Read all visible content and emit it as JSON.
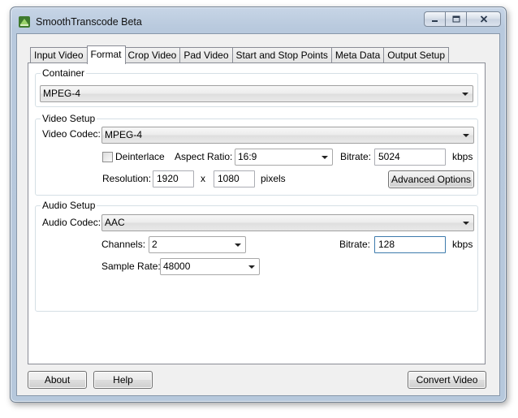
{
  "window": {
    "title": "SmoothTranscode Beta"
  },
  "tabs": [
    {
      "label": "Input Video"
    },
    {
      "label": "Format"
    },
    {
      "label": "Crop Video"
    },
    {
      "label": "Pad Video"
    },
    {
      "label": "Start and Stop Points"
    },
    {
      "label": "Meta Data"
    },
    {
      "label": "Output Setup"
    }
  ],
  "active_tab": "Format",
  "container": {
    "legend": "Container",
    "value": "MPEG-4"
  },
  "video": {
    "legend": "Video Setup",
    "codec_label": "Video Codec:",
    "codec_value": "MPEG-4",
    "deinterlace_label": "Deinterlace",
    "deinterlace_checked": false,
    "aspect_label": "Aspect Ratio:",
    "aspect_value": "16:9",
    "bitrate_label": "Bitrate:",
    "bitrate_value": "5024",
    "bitrate_unit": "kbps",
    "resolution_label": "Resolution:",
    "width_value": "1920",
    "x_label": "x",
    "height_value": "1080",
    "pixels_label": "pixels",
    "advanced_button": "Advanced Options"
  },
  "audio": {
    "legend": "Audio Setup",
    "codec_label": "Audio Codec:",
    "codec_value": "AAC",
    "channels_label": "Channels:",
    "channels_value": "2",
    "bitrate_label": "Bitrate:",
    "bitrate_value": "128",
    "bitrate_unit": "kbps",
    "samplerate_label": "Sample Rate:",
    "samplerate_value": "48000"
  },
  "footer": {
    "about_button": "About",
    "help_button": "Help",
    "convert_button": "Convert Video"
  },
  "icons": {
    "app": "smoothtranscode-app-icon",
    "minimize": "minimize-icon",
    "maximize": "maximize-icon",
    "close": "close-icon",
    "dropdown": "chevron-down-icon"
  }
}
